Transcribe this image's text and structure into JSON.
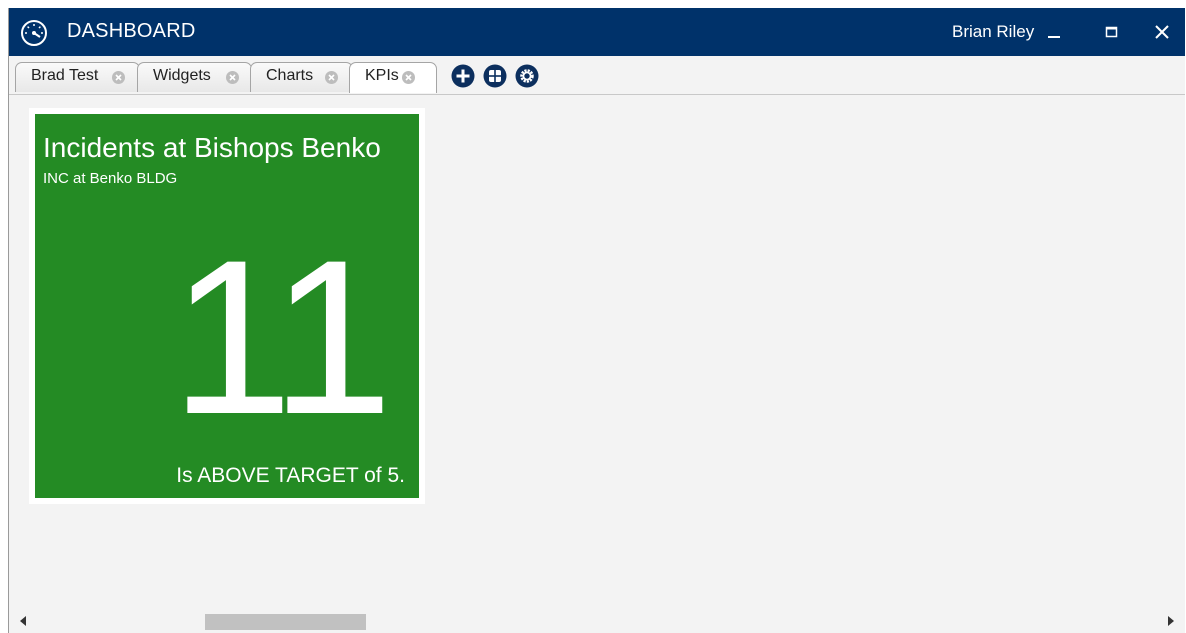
{
  "window": {
    "title": "DASHBOARD",
    "user": "Brian Riley",
    "icon": "speedometer-icon",
    "accent_color": "#00326a"
  },
  "tabs": [
    {
      "label": "Brad Test",
      "active": false
    },
    {
      "label": "Widgets",
      "active": false
    },
    {
      "label": "Charts",
      "active": false
    },
    {
      "label": "KPIs",
      "active": true
    }
  ],
  "toolbar": {
    "buttons": [
      "add-tab-icon",
      "layout-icon",
      "settings-icon"
    ]
  },
  "kpi": {
    "title": "Incidents at Bishops Benko",
    "subtitle": "INC at Benko BLDG",
    "value": "11",
    "status": "Is ABOVE TARGET of 5.",
    "tile_color": "#248b24"
  }
}
